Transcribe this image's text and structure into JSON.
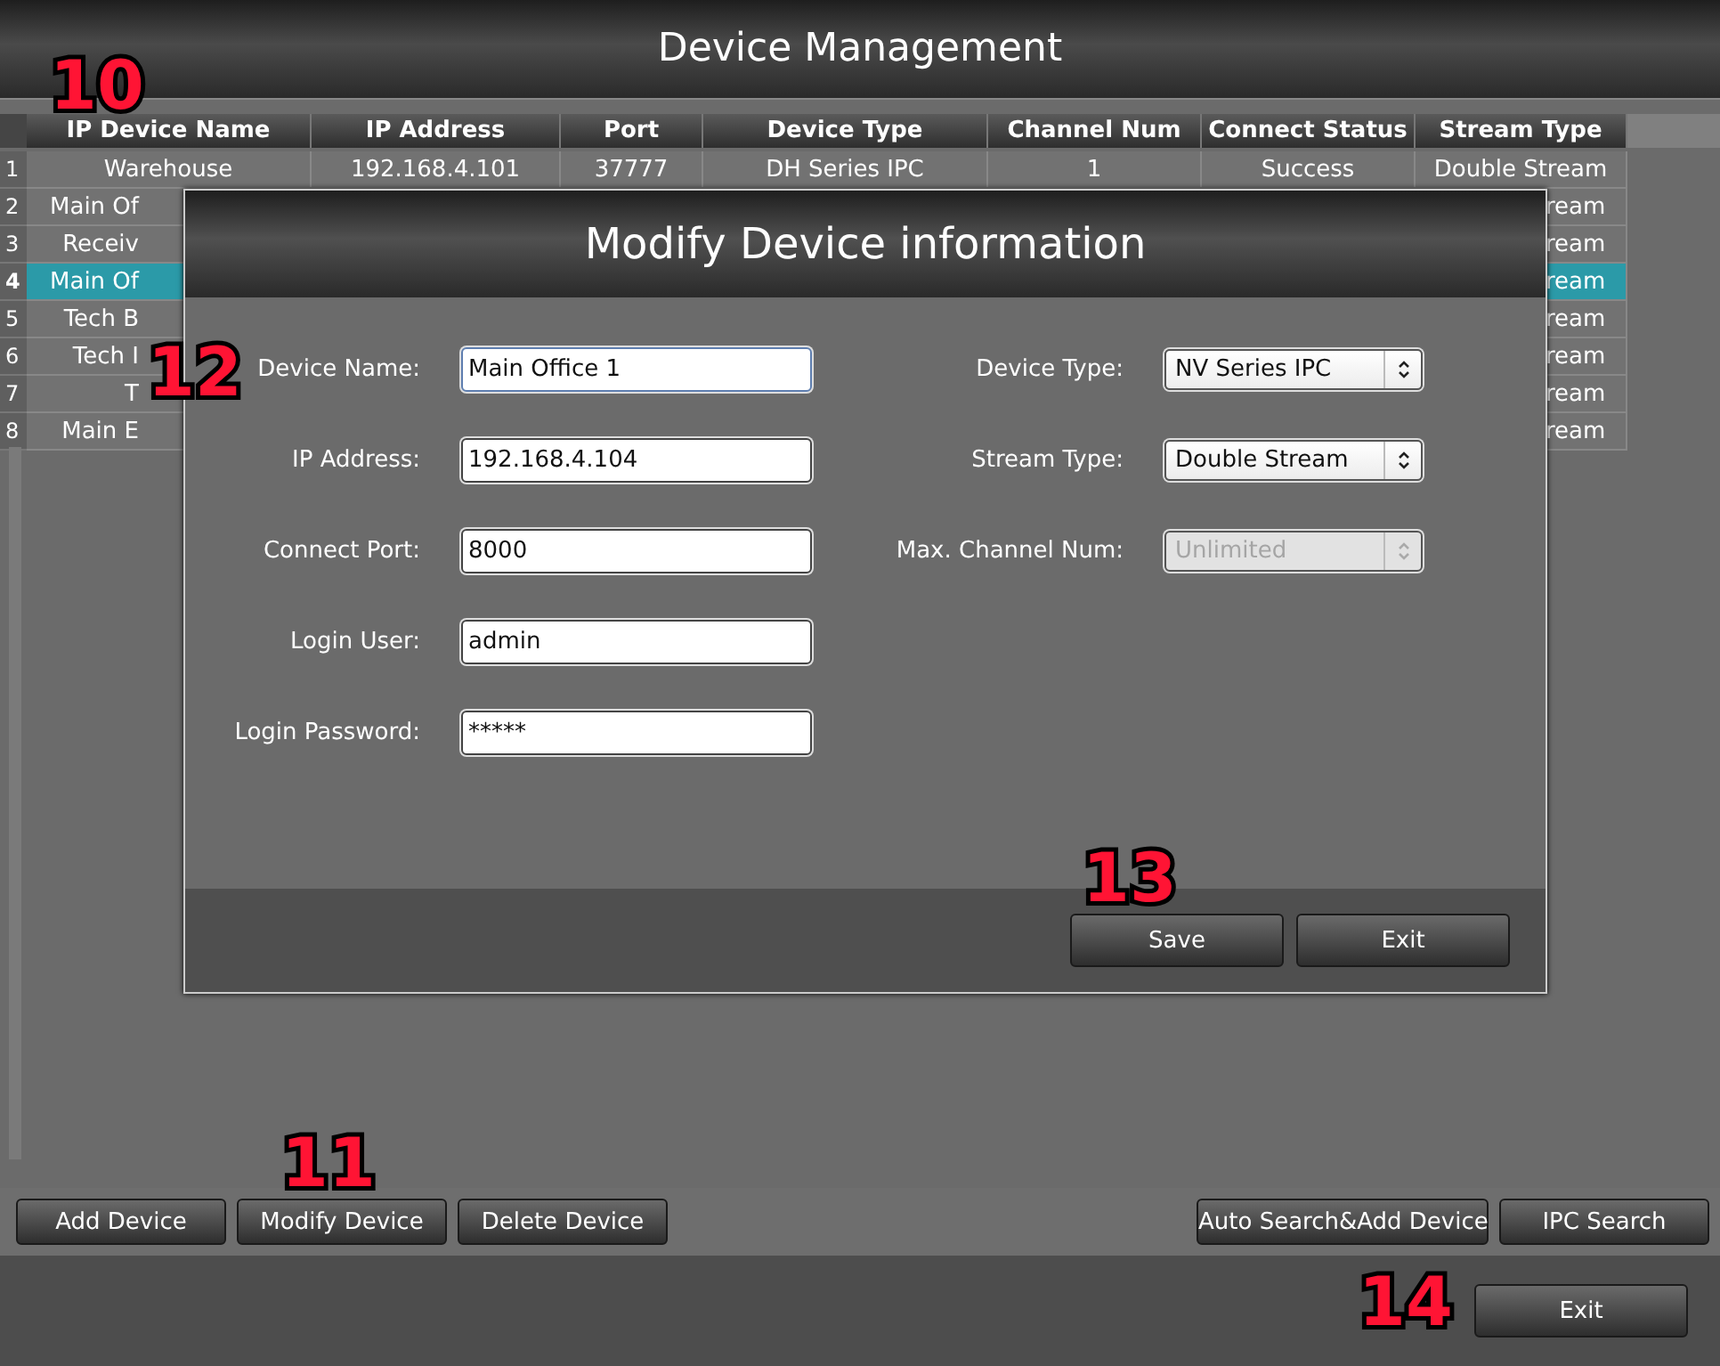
{
  "window": {
    "title": "Device Management"
  },
  "table": {
    "annotation": "10",
    "columns": [
      "IP Device Name",
      "IP Address",
      "Port",
      "Device Type",
      "Channel Num",
      "Connect Status",
      "Stream Type"
    ],
    "rows": [
      {
        "number": "1",
        "selected": false,
        "cells": [
          "Warehouse",
          "192.168.4.101",
          "37777",
          "DH Series IPC",
          "1",
          "Success",
          "Double Stream"
        ]
      },
      {
        "number": "2",
        "selected": false,
        "cells": [
          "Main Of",
          "ream"
        ]
      },
      {
        "number": "3",
        "selected": false,
        "cells": [
          "Receiv",
          "ream"
        ]
      },
      {
        "number": "4",
        "selected": true,
        "cells": [
          "Main Of",
          "ream"
        ]
      },
      {
        "number": "5",
        "selected": false,
        "cells": [
          "Tech B",
          "ream"
        ]
      },
      {
        "number": "6",
        "selected": false,
        "cells": [
          "Tech I",
          "ream"
        ]
      },
      {
        "number": "7",
        "selected": false,
        "cells": [
          "T",
          "ream"
        ]
      },
      {
        "number": "8",
        "selected": false,
        "cells": [
          "Main E",
          "ream"
        ]
      }
    ]
  },
  "toolbar": {
    "left": [
      {
        "label": "Add Device"
      },
      {
        "label": "Modify Device",
        "annotation": "11"
      },
      {
        "label": "Delete Device"
      }
    ],
    "right": [
      {
        "label": "Auto Search&Add Device"
      },
      {
        "label": "IPC Search"
      }
    ]
  },
  "footer": {
    "exit": {
      "label": "Exit",
      "annotation": "14"
    }
  },
  "dialog": {
    "title": "Modify Device information",
    "annotation": "12",
    "left_fields": [
      {
        "label": "Device Name:",
        "kind": "text",
        "value": "Main Office 1",
        "focused": true
      },
      {
        "label": "IP Address:",
        "kind": "text",
        "value": "192.168.4.104",
        "focused": false
      },
      {
        "label": "Connect Port:",
        "kind": "text",
        "value": "8000",
        "focused": false
      },
      {
        "label": "Login User:",
        "kind": "text",
        "value": "admin",
        "focused": false
      },
      {
        "label": "Login Password:",
        "kind": "text",
        "value": "*****",
        "focused": false
      }
    ],
    "right_fields": [
      {
        "label": "Device Type:",
        "kind": "select",
        "value": "NV Series IPC",
        "disabled": false
      },
      {
        "label": "Stream Type:",
        "kind": "select",
        "value": "Double Stream",
        "disabled": false
      },
      {
        "label": "Max. Channel Num:",
        "kind": "select",
        "value": "Unlimited",
        "disabled": true
      }
    ],
    "buttons_annotation": "13",
    "buttons": [
      {
        "label": "Save"
      },
      {
        "label": "Exit"
      }
    ]
  }
}
